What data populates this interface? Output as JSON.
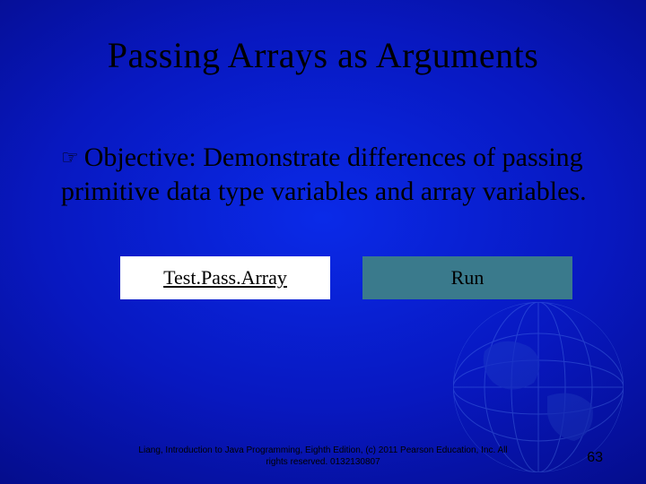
{
  "title": "Passing Arrays as Arguments",
  "bullet": {
    "icon": "☞",
    "objective_label": "Objective:",
    "objective_text": " Demonstrate differences of passing primitive data type variables and array variables."
  },
  "buttons": {
    "link_label": "Test.Pass.Array",
    "run_label": "Run"
  },
  "footer": {
    "line1": "Liang, Introduction to Java Programming, Eighth Edition, (c) 2011 Pearson Education, Inc. All",
    "line2": "rights reserved. 0132130807"
  },
  "page_number": "63"
}
